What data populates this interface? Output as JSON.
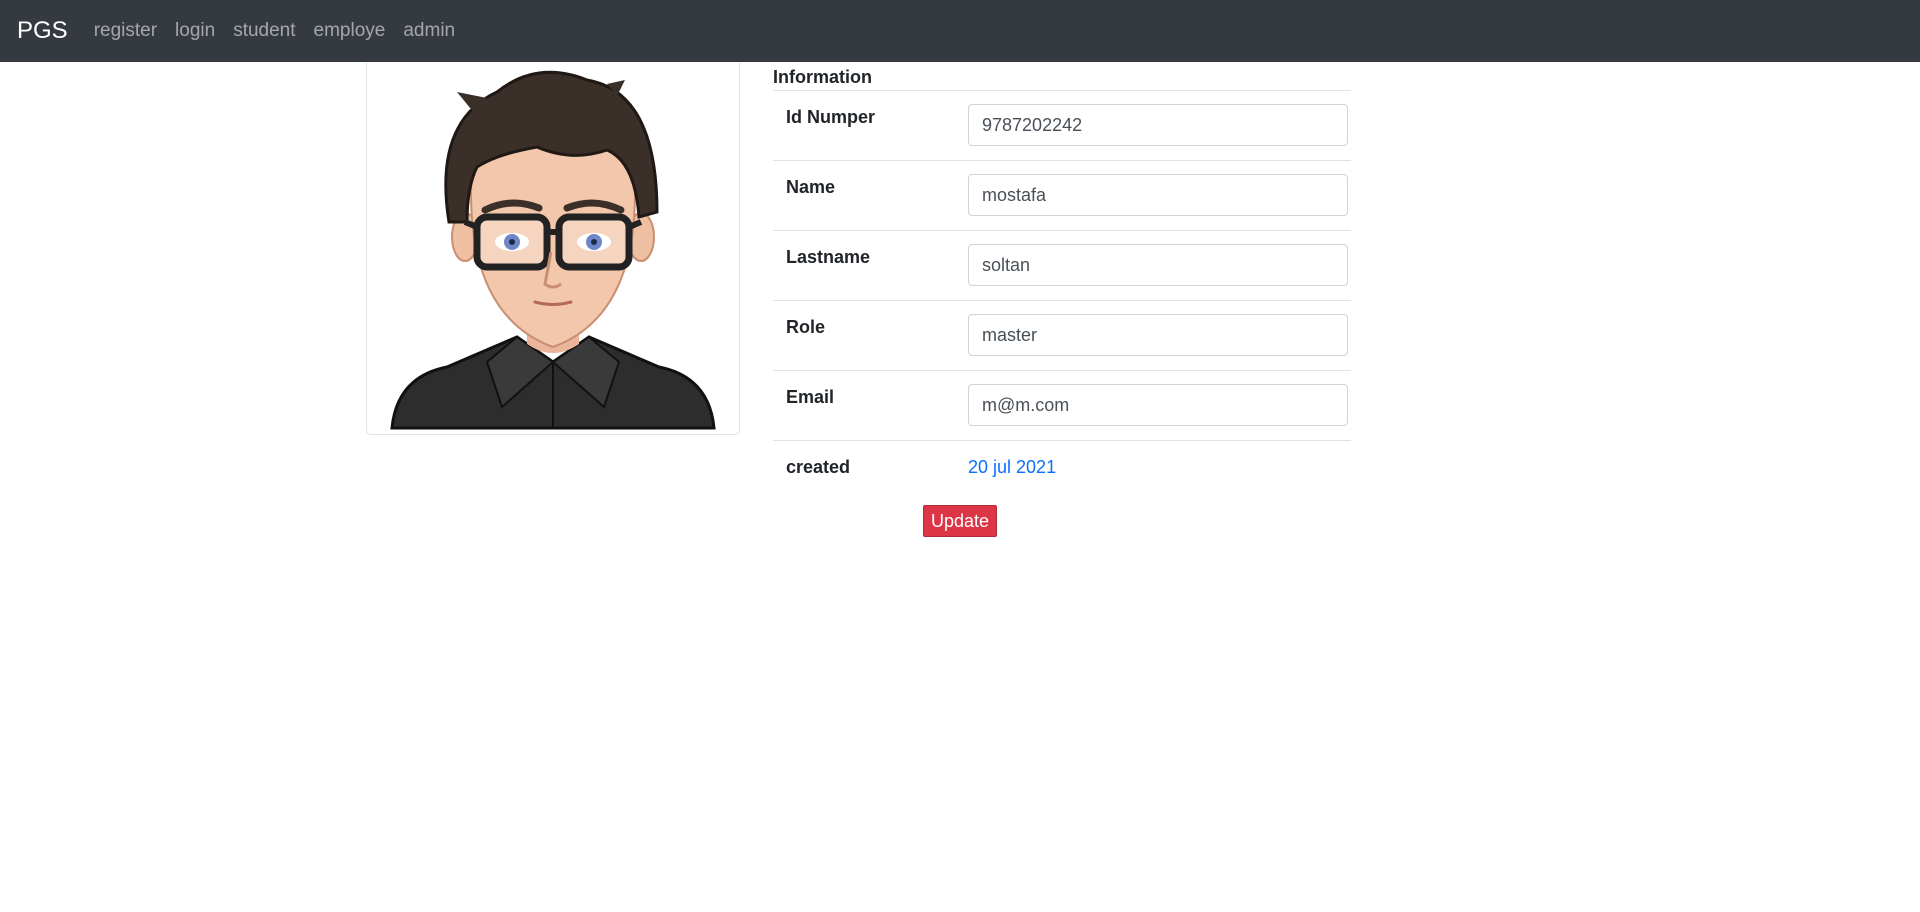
{
  "navbar": {
    "brand": "PGS",
    "links": [
      "register",
      "login",
      "student",
      "employe",
      "admin"
    ]
  },
  "avatar": {
    "icon": "male-avatar-glasses"
  },
  "info": {
    "title": "Information",
    "fields": [
      {
        "label": "Id Numper",
        "value": "9787202242"
      },
      {
        "label": "Name",
        "value": "mostafa"
      },
      {
        "label": "Lastname",
        "value": "soltan"
      },
      {
        "label": "Role",
        "value": "master"
      },
      {
        "label": "Email",
        "value": "m@m.com"
      }
    ],
    "created_label": "created",
    "created_value": "20 jul 2021"
  },
  "actions": {
    "update_label": "Update"
  },
  "colors": {
    "navbar_bg": "#343a40",
    "update_button": "#dc3545",
    "date_link": "#0d6efd"
  }
}
